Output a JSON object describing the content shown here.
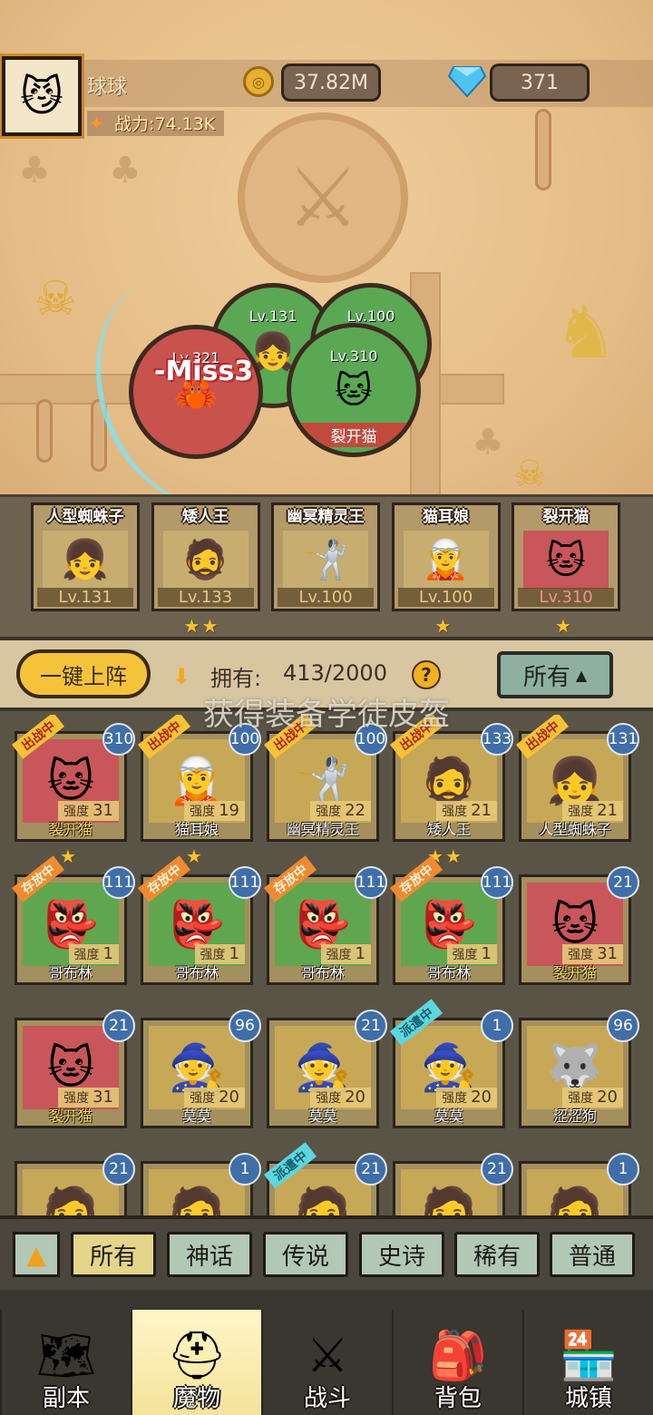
{
  "player": {
    "name": "球球",
    "gold": "37.82M",
    "gems": "371",
    "power": "战力:74.13K"
  },
  "battle": {
    "units": [
      {
        "level": "Lv.131",
        "name": "",
        "color": "green"
      },
      {
        "level": "Lv.100",
        "name": "",
        "color": "green"
      },
      {
        "level": "Lv.321",
        "name": "",
        "color": "red"
      },
      {
        "level": "Lv.310",
        "name": "裂开猫",
        "color": "green"
      }
    ],
    "miss_text": "-Miss3"
  },
  "team": [
    {
      "name": "人型蜘蛛子",
      "level": "Lv.131",
      "stars": 0,
      "bg": "gold",
      "icon": "spider-girl-icon"
    },
    {
      "name": "矮人王",
      "level": "Lv.133",
      "stars": 2,
      "bg": "gold",
      "icon": "dwarf-king-icon"
    },
    {
      "name": "幽冥精灵王",
      "level": "Lv.100",
      "stars": 0,
      "bg": "gold",
      "icon": "elf-king-icon"
    },
    {
      "name": "猫耳娘",
      "level": "Lv.100",
      "stars": 1,
      "bg": "gold",
      "icon": "cat-girl-icon"
    },
    {
      "name": "裂开猫",
      "level": "Lv.310",
      "stars": 1,
      "bg": "red",
      "icon": "split-cat-icon"
    }
  ],
  "controls": {
    "auto_deploy": "一键上阵",
    "own_label": "拥有:",
    "own_count": "413/2000",
    "help": "?",
    "filter": "所有",
    "filter_arrow": "▲",
    "toast": "获得装备学徒皮盔"
  },
  "cards": [
    {
      "name": "裂开猫",
      "level": "310",
      "power_label": "强度",
      "power": "31",
      "bg": "red",
      "tag": "出战中",
      "tag_type": "out",
      "stars": 1
    },
    {
      "name": "猫耳娘",
      "level": "100",
      "power_label": "强度",
      "power": "19",
      "bg": "gold",
      "tag": "出战中",
      "tag_type": "out",
      "stars": 1
    },
    {
      "name": "幽冥精灵王",
      "level": "100",
      "power_label": "强度",
      "power": "22",
      "bg": "gold",
      "tag": "出战中",
      "tag_type": "out",
      "stars": 0
    },
    {
      "name": "矮人王",
      "level": "133",
      "power_label": "强度",
      "power": "21",
      "bg": "gold",
      "tag": "出战中",
      "tag_type": "out",
      "stars": 2
    },
    {
      "name": "人型蜘蛛子",
      "level": "131",
      "power_label": "强度",
      "power": "21",
      "bg": "gold",
      "tag": "出战中",
      "tag_type": "out",
      "stars": 0
    },
    {
      "name": "哥布林",
      "level": "111",
      "power_label": "强度",
      "power": "1",
      "bg": "green",
      "tag": "存放中",
      "tag_type": "store",
      "stars": 0
    },
    {
      "name": "哥布林",
      "level": "111",
      "power_label": "强度",
      "power": "1",
      "bg": "green",
      "tag": "存放中",
      "tag_type": "store",
      "stars": 0
    },
    {
      "name": "哥布林",
      "level": "111",
      "power_label": "强度",
      "power": "1",
      "bg": "green",
      "tag": "存放中",
      "tag_type": "store",
      "stars": 0
    },
    {
      "name": "哥布林",
      "level": "111",
      "power_label": "强度",
      "power": "1",
      "bg": "green",
      "tag": "存放中",
      "tag_type": "store",
      "stars": 0
    },
    {
      "name": "裂开猫",
      "level": "21",
      "power_label": "强度",
      "power": "31",
      "bg": "red",
      "tag": "",
      "tag_type": "",
      "stars": 0
    },
    {
      "name": "裂开猫",
      "level": "21",
      "power_label": "强度",
      "power": "31",
      "bg": "red",
      "tag": "",
      "tag_type": "",
      "stars": 0
    },
    {
      "name": "莫莫",
      "level": "96",
      "power_label": "强度",
      "power": "20",
      "bg": "gold",
      "tag": "",
      "tag_type": "",
      "stars": 0
    },
    {
      "name": "莫莫",
      "level": "21",
      "power_label": "强度",
      "power": "20",
      "bg": "gold",
      "tag": "",
      "tag_type": "",
      "stars": 0
    },
    {
      "name": "莫莫",
      "level": "1",
      "power_label": "强度",
      "power": "20",
      "bg": "gold",
      "tag": "派遣中",
      "tag_type": "dispatch",
      "stars": 0
    },
    {
      "name": "涩涩狗",
      "level": "96",
      "power_label": "强度",
      "power": "20",
      "bg": "gold",
      "tag": "",
      "tag_type": "",
      "stars": 0
    },
    {
      "name": "",
      "level": "21",
      "power_label": "",
      "power": "",
      "bg": "gold",
      "tag": "",
      "tag_type": "",
      "stars": 0
    },
    {
      "name": "",
      "level": "1",
      "power_label": "",
      "power": "",
      "bg": "gold",
      "tag": "",
      "tag_type": "",
      "stars": 0
    },
    {
      "name": "",
      "level": "21",
      "power_label": "",
      "power": "",
      "bg": "gold",
      "tag": "派遣中",
      "tag_type": "dispatch",
      "stars": 0
    },
    {
      "name": "",
      "level": "21",
      "power_label": "",
      "power": "",
      "bg": "gold",
      "tag": "",
      "tag_type": "",
      "stars": 0
    },
    {
      "name": "",
      "level": "1",
      "power_label": "",
      "power": "",
      "bg": "gold",
      "tag": "",
      "tag_type": "",
      "stars": 0
    }
  ],
  "rarity_tabs": [
    "所有",
    "神话",
    "传说",
    "史诗",
    "稀有",
    "普通"
  ],
  "nav": [
    {
      "label": "副本",
      "icon": "map-icon"
    },
    {
      "label": "魔物",
      "icon": "monster-helmet-icon"
    },
    {
      "label": "战斗",
      "icon": "crossed-swords-icon"
    },
    {
      "label": "背包",
      "icon": "backpack-icon"
    },
    {
      "label": "城镇",
      "icon": "town-shop-icon"
    }
  ],
  "colors": {
    "gold_bg": "#c7a857",
    "red_bg": "#c8565a",
    "green_bg": "#5fa64f",
    "accent_yellow": "#f5c33a"
  }
}
